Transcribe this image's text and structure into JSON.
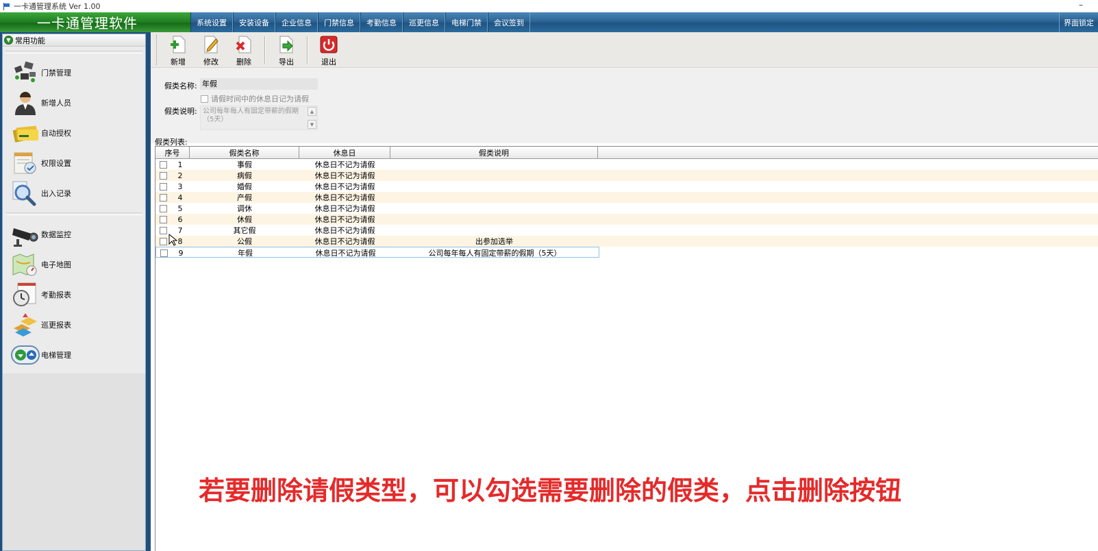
{
  "window": {
    "title": "一卡通管理系统  Ver 1.00",
    "minimize": "–"
  },
  "menubar": {
    "brand": "一卡通管理软件",
    "items": [
      "系统设置",
      "安装设备",
      "企业信息",
      "门禁信息",
      "考勤信息",
      "巡更信息",
      "电梯门禁",
      "会议签到"
    ],
    "right": "界面锁定"
  },
  "sidebar": {
    "header": "常用功能",
    "items": [
      {
        "label": "门禁管理",
        "icon": "door-access-icon"
      },
      {
        "label": "新增人员",
        "icon": "person-icon"
      },
      {
        "label": "自动授权",
        "icon": "card-stack-icon"
      },
      {
        "label": "权限设置",
        "icon": "permission-icon"
      },
      {
        "label": "出入记录",
        "icon": "magnifier-icon"
      },
      {
        "label": "数据监控",
        "icon": "camera-icon"
      },
      {
        "label": "电子地图",
        "icon": "map-icon"
      },
      {
        "label": "考勤报表",
        "icon": "clock-icon"
      },
      {
        "label": "巡更报表",
        "icon": "patrol-icon"
      },
      {
        "label": "电梯管理",
        "icon": "elevator-icon"
      }
    ]
  },
  "toolbar": {
    "add": "新增",
    "edit": "修改",
    "delete": "删除",
    "export": "导出",
    "exit": "退出"
  },
  "form": {
    "name_label": "假类名称:",
    "name_value": "年假",
    "checkbox_label": "请假时间中的休息日记为请假",
    "desc_label": "假类说明:",
    "desc_value": "公司每年每人有固定带薪的假期（5天）"
  },
  "list": {
    "label": "假类列表:",
    "columns": [
      "序号",
      "假类名称",
      "休息日",
      "假类说明"
    ],
    "rows": [
      {
        "no": "1",
        "name": "事假",
        "rest": "休息日不记为请假",
        "desc": ""
      },
      {
        "no": "2",
        "name": "病假",
        "rest": "休息日不记为请假",
        "desc": ""
      },
      {
        "no": "3",
        "name": "婚假",
        "rest": "休息日不记为请假",
        "desc": ""
      },
      {
        "no": "4",
        "name": "产假",
        "rest": "休息日不记为请假",
        "desc": ""
      },
      {
        "no": "5",
        "name": "调休",
        "rest": "休息日不记为请假",
        "desc": ""
      },
      {
        "no": "6",
        "name": "休假",
        "rest": "休息日不记为请假",
        "desc": ""
      },
      {
        "no": "7",
        "name": "其它假",
        "rest": "休息日不记为请假",
        "desc": ""
      },
      {
        "no": "8",
        "name": "公假",
        "rest": "休息日不记为请假",
        "desc": "出参加选举"
      },
      {
        "no": "9",
        "name": "年假",
        "rest": "休息日不记为请假",
        "desc": "公司每年每人有固定带薪的假期（5天）"
      }
    ]
  },
  "caption": "若要删除请假类型，可以勾选需要删除的假类，点击删除按钮"
}
